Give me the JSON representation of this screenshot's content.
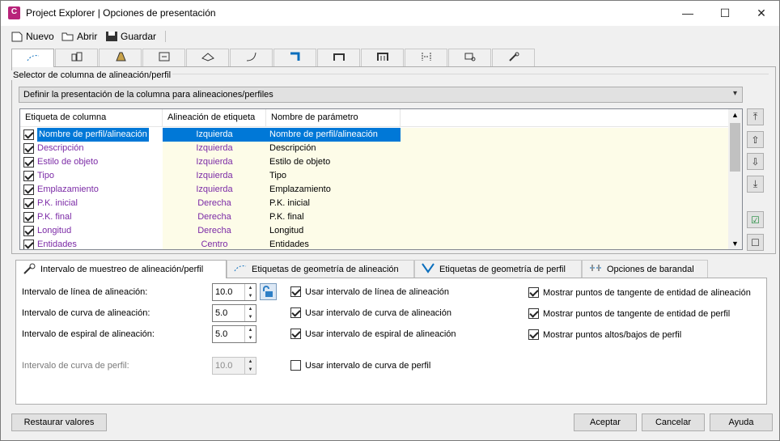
{
  "window": {
    "title": "Project Explorer | Opciones de presentación",
    "app_icon_letter": "C",
    "minimize": "—",
    "maximize": "☐",
    "close": "✕"
  },
  "toolbar": {
    "new_label": "Nuevo",
    "open_label": "Abrir",
    "save_label": "Guardar"
  },
  "top_tabs": [
    {
      "icon": "alignment-path-icon"
    },
    {
      "icon": "buildings-icon"
    },
    {
      "icon": "road-icon"
    },
    {
      "icon": "frame-icon"
    },
    {
      "icon": "surface-icon"
    },
    {
      "icon": "curve-icon"
    },
    {
      "icon": "corridor-icon"
    },
    {
      "icon": "pipe-network-icon"
    },
    {
      "icon": "pressure-pipe-icon"
    },
    {
      "icon": "section-icon"
    },
    {
      "icon": "inspection-icon"
    },
    {
      "icon": "wrench-icon"
    }
  ],
  "selector": {
    "group_title": "Selector de columna de alineación/perfil",
    "combo_value": "Definir la presentación de la columna para alineaciones/perfiles"
  },
  "grid": {
    "headers": [
      "Etiqueta de columna",
      "Alineación de etiqueta",
      "Nombre de parámetro"
    ],
    "rows": [
      {
        "label": "Nombre de perfil/alineación",
        "align": "Izquierda",
        "param": "Nombre de perfil/alineación",
        "checked": true,
        "selected": true
      },
      {
        "label": "Descripción",
        "align": "Izquierda",
        "param": "Descripción",
        "checked": true
      },
      {
        "label": "Estilo de objeto",
        "align": "Izquierda",
        "param": "Estilo de objeto",
        "checked": true
      },
      {
        "label": "Tipo",
        "align": "Izquierda",
        "param": "Tipo",
        "checked": true
      },
      {
        "label": "Emplazamiento",
        "align": "Izquierda",
        "param": "Emplazamiento",
        "checked": true
      },
      {
        "label": "P.K. inicial",
        "align": "Derecha",
        "param": "P.K. inicial",
        "checked": true
      },
      {
        "label": "P.K. final",
        "align": "Derecha",
        "param": "P.K. final",
        "checked": true
      },
      {
        "label": "Longitud",
        "align": "Derecha",
        "param": "Longitud",
        "checked": true
      },
      {
        "label": "Entidades",
        "align": "Centro",
        "param": "Entidades",
        "checked": true
      }
    ]
  },
  "side_buttons": {
    "top": "⤒",
    "up": "⇧",
    "down": "⇩",
    "bottom": "⤓",
    "check_all": "☑",
    "uncheck_all": "☐"
  },
  "bottom_tabs": [
    {
      "label": "Intervalo de muestreo de alineación/perfil",
      "icon": "wrench-icon"
    },
    {
      "label": "Etiquetas de geometría de alineación",
      "icon": "alignment-path-icon"
    },
    {
      "label": "Etiquetas de geometría de perfil",
      "icon": "profile-icon"
    },
    {
      "label": "Opciones de barandal",
      "icon": "railing-icon"
    }
  ],
  "intervals": {
    "alignment_line": {
      "label": "Intervalo de línea de alineación:",
      "value": "10.0"
    },
    "alignment_curve": {
      "label": "Intervalo de curva de alineación:",
      "value": "5.0"
    },
    "alignment_spiral": {
      "label": "Intervalo de espiral de alineación:",
      "value": "5.0"
    },
    "profile_curve": {
      "label": "Intervalo de curva de perfil:",
      "value": "10.0"
    }
  },
  "use_checks": [
    {
      "label": "Usar intervalo de línea de alineación",
      "checked": true
    },
    {
      "label": "Usar intervalo de curva de alineación",
      "checked": true
    },
    {
      "label": "Usar intervalo de espiral de alineación",
      "checked": true
    },
    {
      "label": "Usar intervalo de curva de perfil",
      "checked": false
    }
  ],
  "show_checks": [
    {
      "label": "Mostrar puntos de tangente de entidad de alineación",
      "checked": true
    },
    {
      "label": "Mostrar puntos de tangente de entidad de perfil",
      "checked": true
    },
    {
      "label": "Mostrar puntos altos/bajos de perfil",
      "checked": true
    }
  ],
  "footer": {
    "restore": "Restaurar valores",
    "accept": "Aceptar",
    "cancel": "Cancelar",
    "help": "Ayuda"
  }
}
